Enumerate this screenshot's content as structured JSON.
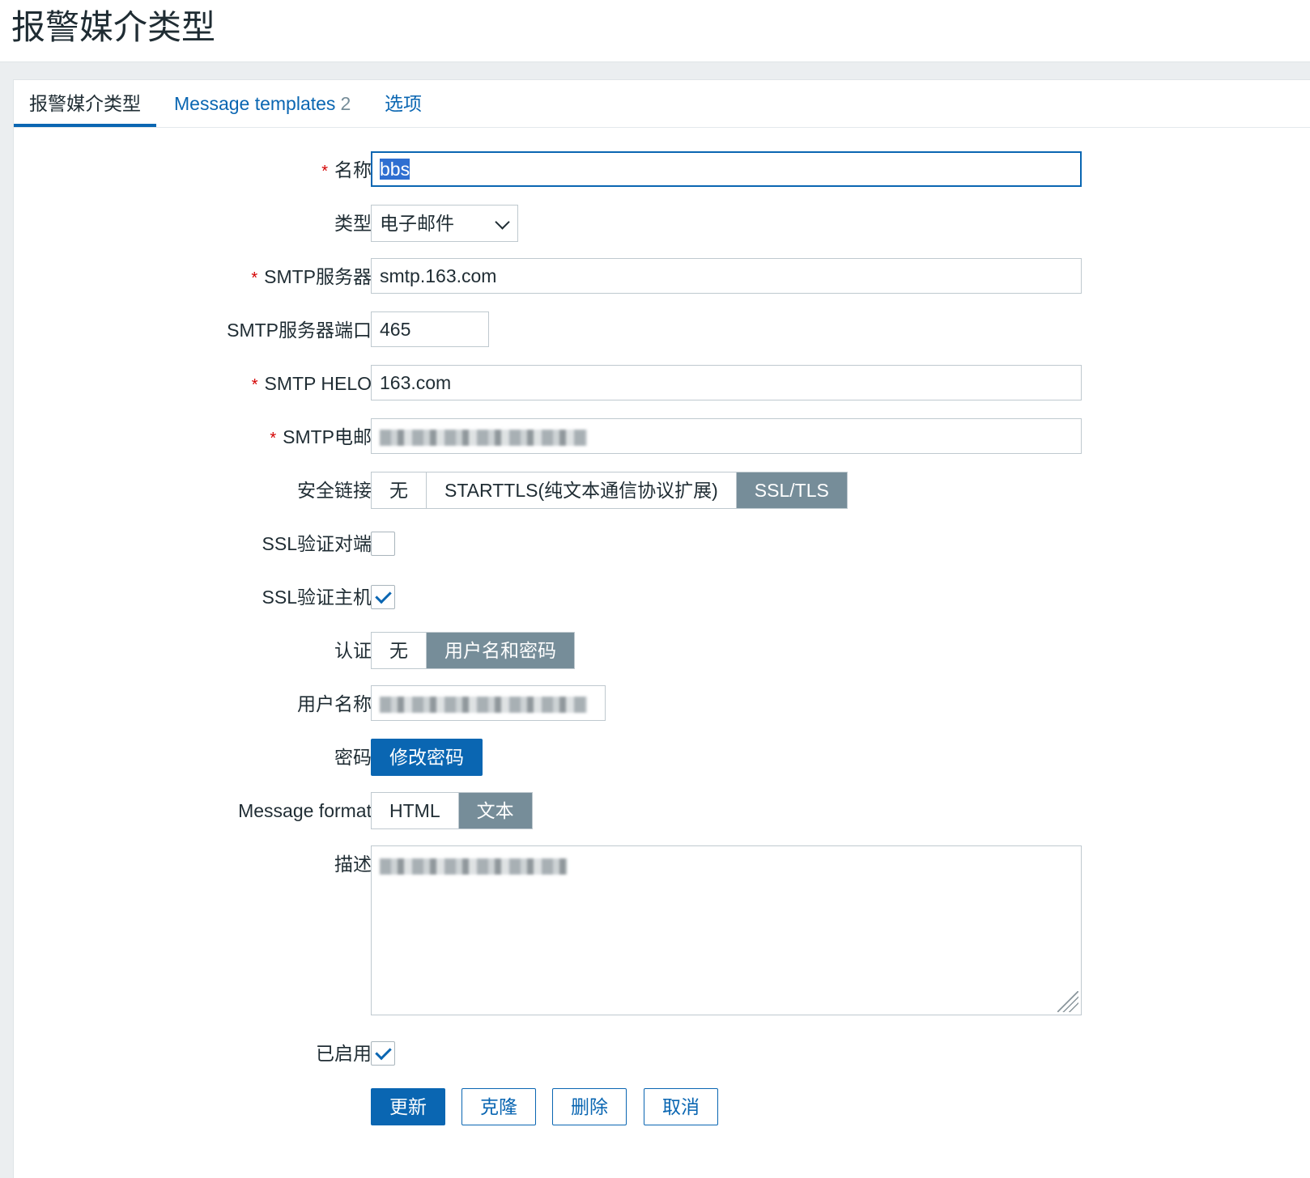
{
  "page": {
    "title": "报警媒介类型"
  },
  "tabs": [
    {
      "label": "报警媒介类型"
    },
    {
      "label": "Message templates",
      "count": "2"
    },
    {
      "label": "选项"
    }
  ],
  "form": {
    "name": {
      "label": "名称",
      "value": "bbs",
      "required": true
    },
    "type": {
      "label": "类型",
      "value": "电子邮件"
    },
    "smtp_server": {
      "label": "SMTP服务器",
      "value": "smtp.163.com",
      "required": true
    },
    "smtp_port": {
      "label": "SMTP服务器端口",
      "value": "465"
    },
    "smtp_helo": {
      "label": "SMTP HELO",
      "value": "163.com",
      "required": true
    },
    "smtp_email": {
      "label": "SMTP电邮",
      "value": "",
      "required": true
    },
    "security": {
      "label": "安全链接",
      "options": [
        "无",
        "STARTTLS(纯文本通信协议扩展)",
        "SSL/TLS"
      ],
      "selected": "SSL/TLS"
    },
    "ssl_verify_peer": {
      "label": "SSL验证对端",
      "checked": false
    },
    "ssl_verify_host": {
      "label": "SSL验证主机",
      "checked": true
    },
    "auth": {
      "label": "认证",
      "options": [
        "无",
        "用户名和密码"
      ],
      "selected": "用户名和密码"
    },
    "username": {
      "label": "用户名称",
      "value": ""
    },
    "password": {
      "label": "密码",
      "button": "修改密码"
    },
    "message_format": {
      "label": "Message format",
      "options": [
        "HTML",
        "文本"
      ],
      "selected": "文本"
    },
    "description": {
      "label": "描述",
      "value": ""
    },
    "enabled": {
      "label": "已启用",
      "checked": true
    }
  },
  "actions": {
    "update": "更新",
    "clone": "克隆",
    "delete": "删除",
    "cancel": "取消"
  },
  "colors": {
    "primary": "#0a66b2",
    "segment_on": "#768d99",
    "required": "#d40000"
  }
}
